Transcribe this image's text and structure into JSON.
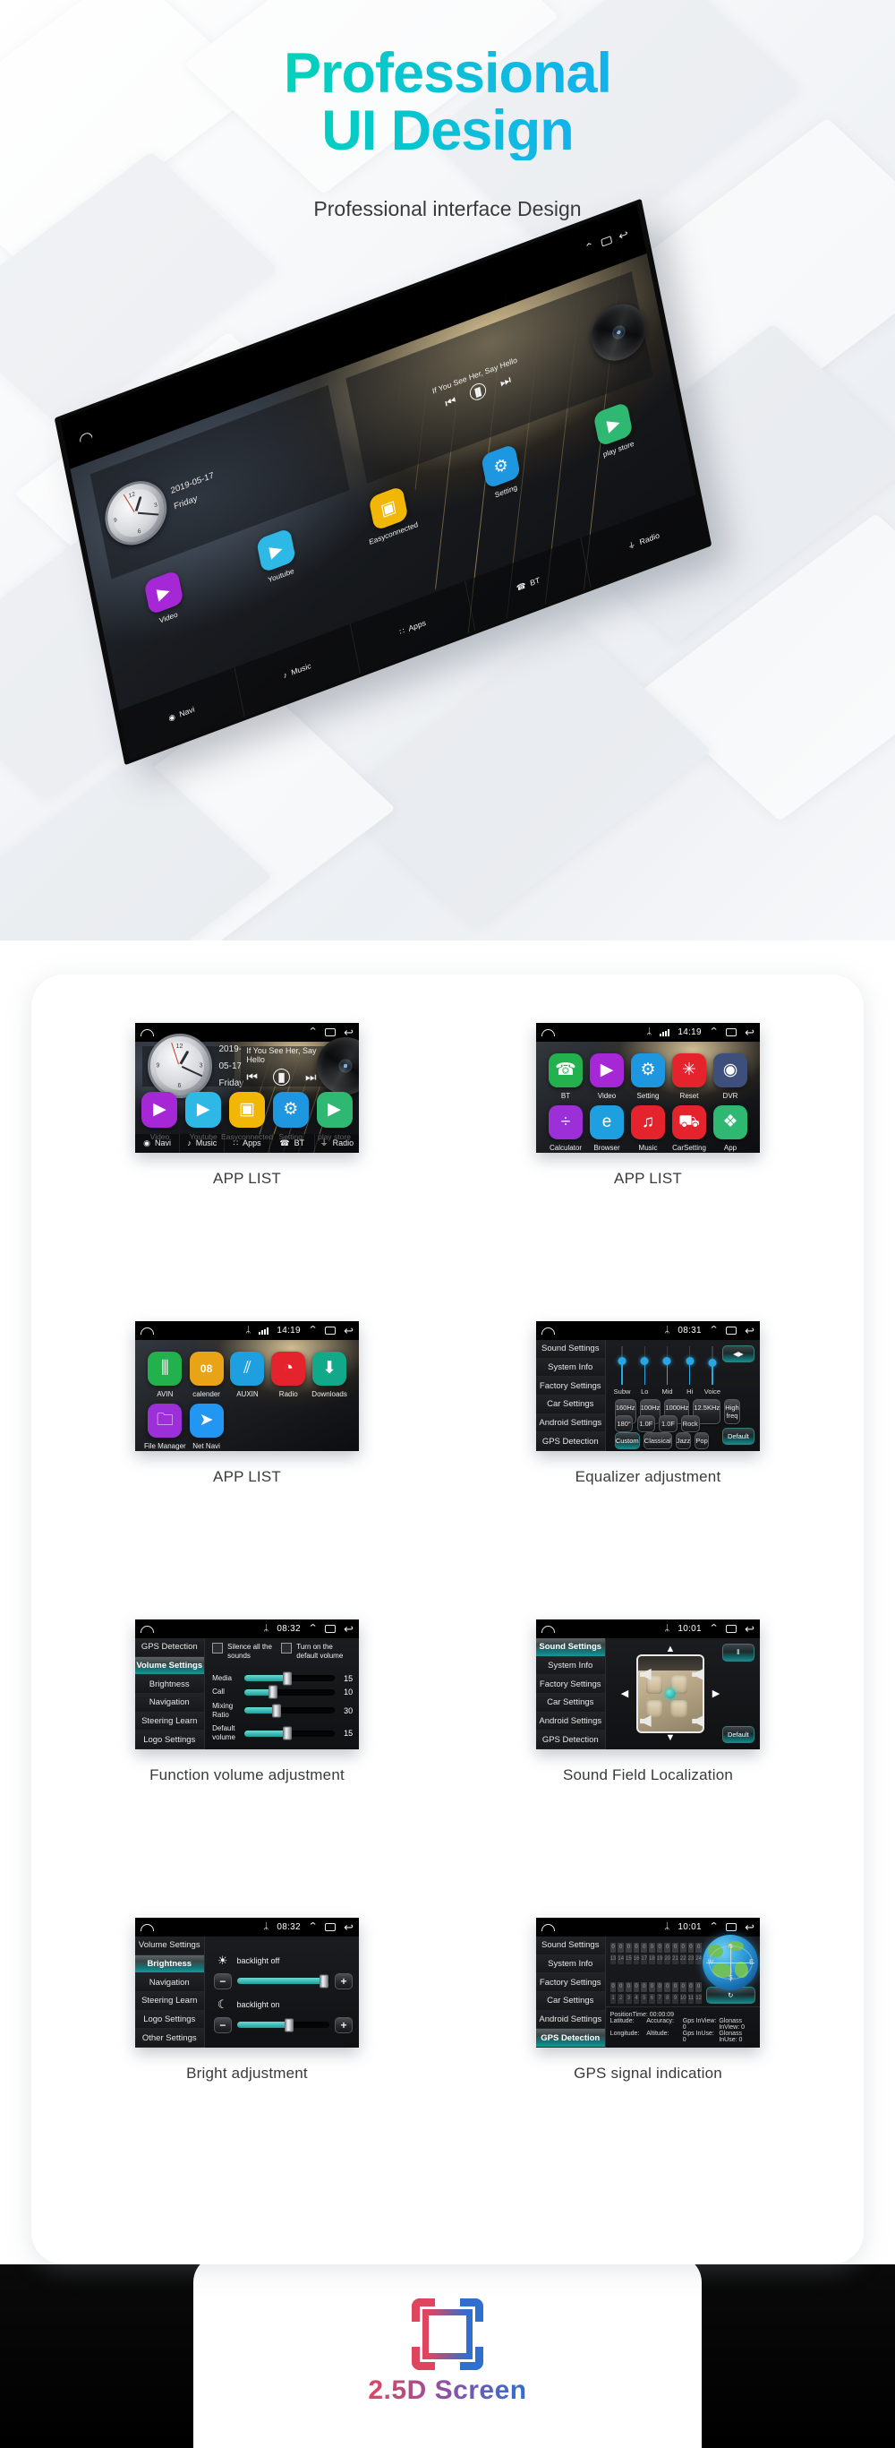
{
  "hero": {
    "title_line1": "Professional",
    "title_line2": "UI Design",
    "subtitle": "Professional interface Design",
    "gradient_start": "#00eb9b",
    "gradient_end": "#1f9cf5"
  },
  "home_screen": {
    "statusbar": {
      "home_icon": "home-icon",
      "up_icon": "collapse-icon",
      "recent_icon": "recents-icon",
      "back_icon": "back-icon"
    },
    "clock_widget": {
      "date": "2019-05-17",
      "weekday": "Friday",
      "numerals": [
        "12",
        "3",
        "6",
        "9"
      ]
    },
    "music_widget": {
      "track": "If You See Her, Say Hello",
      "prev": "❘◀",
      "play": "❘❘",
      "next": "▶❘"
    },
    "apps": [
      {
        "label": "Video",
        "icon": "video-icon",
        "color": "#a627d6"
      },
      {
        "label": "Youtube",
        "icon": "youtube-icon",
        "color": "#2eb8e6"
      },
      {
        "label": "Easyconnected",
        "icon": "easyconnected-icon",
        "color": "#f2b705"
      },
      {
        "label": "Setting",
        "icon": "gear-icon",
        "color": "#1e97e0"
      },
      {
        "label": "play store",
        "icon": "playstore-icon",
        "color": "#2eb872"
      }
    ],
    "dock": [
      {
        "label": "Navi",
        "icon": "location-pin-icon"
      },
      {
        "label": "Music",
        "icon": "music-note-icon"
      },
      {
        "label": "Apps",
        "icon": "grid-apps-icon"
      },
      {
        "label": "BT",
        "icon": "bluetooth-phone-icon"
      },
      {
        "label": "Radio",
        "icon": "radio-icon"
      }
    ]
  },
  "cards": [
    {
      "caption": "APP LIST",
      "type": "home",
      "statusbar": {
        "time": "",
        "bluetooth": false,
        "signal": false
      }
    },
    {
      "caption": "APP LIST",
      "type": "grid",
      "statusbar": {
        "time": "14:19",
        "bluetooth": true,
        "signal": true
      },
      "apps": [
        {
          "label": "BT",
          "icon": "bluetooth-phone-icon",
          "color": "#22b14c"
        },
        {
          "label": "Video",
          "icon": "video-icon",
          "color": "#a627d6"
        },
        {
          "label": "Setting",
          "icon": "gear-icon",
          "color": "#1e97e0"
        },
        {
          "label": "Reset",
          "icon": "reset-icon",
          "color": "#e5232c"
        },
        {
          "label": "DVR",
          "icon": "camera-icon",
          "color": "#3d4f7a"
        },
        {
          "label": "Calculator",
          "icon": "calculator-icon",
          "color": "#9b30d9"
        },
        {
          "label": "Browser",
          "icon": "browser-e-icon",
          "color": "#1e9fe0"
        },
        {
          "label": "Music",
          "icon": "headphones-icon",
          "color": "#e5232c"
        },
        {
          "label": "CarSetting",
          "icon": "car-settings-icon",
          "color": "#e5232c"
        },
        {
          "label": "App",
          "icon": "apps-grid-icon",
          "color": "#2eb872"
        }
      ]
    },
    {
      "caption": "APP LIST",
      "type": "grid",
      "statusbar": {
        "time": "14:19",
        "bluetooth": true,
        "signal": true
      },
      "apps": [
        {
          "label": "AVIN",
          "icon": "avin-plugs-icon",
          "color": "#22b14c"
        },
        {
          "label": "calender",
          "icon": "calendar-icon",
          "color": "#e8a317",
          "badge": "08"
        },
        {
          "label": "AUXIN",
          "icon": "auxin-plugs-icon",
          "color": "#1e9fe0"
        },
        {
          "label": "Radio",
          "icon": "radio-dial-icon",
          "color": "#e5232c"
        },
        {
          "label": "Downloads",
          "icon": "download-icon",
          "color": "#12a88a"
        },
        {
          "label": "File Manager",
          "icon": "folder-icon",
          "color": "#9b30d9"
        },
        {
          "label": "Net Navi",
          "icon": "paper-plane-icon",
          "color": "#2196f3"
        }
      ]
    },
    {
      "caption": "Equalizer adjustment",
      "type": "equalizer",
      "statusbar": {
        "time": "08:31",
        "bluetooth": true,
        "signal": false
      },
      "nav": [
        "Sound Settings",
        "System Info",
        "Factory Settings",
        "Car Settings",
        "Android Settings",
        "GPS Detection"
      ],
      "nav_active": -1,
      "sliders": [
        {
          "label": "Subw",
          "value": 62
        },
        {
          "label": "Lo",
          "value": 62
        },
        {
          "label": "Mid",
          "value": 62
        },
        {
          "label": "Hi",
          "value": 60
        },
        {
          "label": "Voice",
          "value": 56
        }
      ],
      "row1": [
        "160Hz",
        "100Hz",
        "1000Hz",
        "12.5KHz",
        "High freq"
      ],
      "row2": [
        "180°",
        "1.0F",
        "1.0F",
        "Rock"
      ],
      "row3": [
        "Custom",
        "Classical",
        "Jazz",
        "Pop"
      ],
      "row3_active": 0,
      "balance_button": "balance-icon",
      "default_button": "Default"
    },
    {
      "caption": "Function volume adjustment",
      "type": "volume",
      "statusbar": {
        "time": "08:32",
        "bluetooth": true,
        "signal": false
      },
      "nav": [
        "GPS Detection",
        "Volume Settings",
        "Brightness",
        "Navigation",
        "Steering Learn",
        "Logo Settings"
      ],
      "nav_active": 1,
      "checkboxes": [
        "Silence all the sounds",
        "Turn on the default volume"
      ],
      "rows": [
        {
          "label": "Media",
          "value": 15,
          "pct": 48
        },
        {
          "label": "Call",
          "value": 10,
          "pct": 32
        },
        {
          "label": "Mixing Ratio",
          "value": 30,
          "pct": 36
        },
        {
          "label": "Default volume",
          "value": 15,
          "pct": 48
        }
      ]
    },
    {
      "caption": "Sound Field Localization",
      "type": "soundfield",
      "statusbar": {
        "time": "10:01",
        "bluetooth": true,
        "signal": false
      },
      "nav": [
        "Sound Settings",
        "System Info",
        "Factory Settings",
        "Car Settings",
        "Android Settings",
        "GPS Detection"
      ],
      "nav_active": 0,
      "arrow_up": "▲",
      "arrow_down": "▼",
      "arrow_left": "◀",
      "arrow_right": "▶",
      "eq_button": "equalizer-icon",
      "default_button": "Default"
    },
    {
      "caption": "Bright adjustment",
      "type": "brightness",
      "statusbar": {
        "time": "08:32",
        "bluetooth": true,
        "signal": false
      },
      "nav": [
        "Volume Settings",
        "Brightness",
        "Navigation",
        "Steering Learn",
        "Logo Settings",
        "Other Settings"
      ],
      "nav_active": 1,
      "blocks": [
        {
          "icon": "sun-icon",
          "label": "backlight off",
          "pct": 94,
          "minus": "−",
          "plus": "+"
        },
        {
          "icon": "moon-icon",
          "label": "backlight on",
          "pct": 56,
          "minus": "−",
          "plus": "+"
        }
      ]
    },
    {
      "caption": "GPS signal indication",
      "type": "gps",
      "statusbar": {
        "time": "10:01",
        "bluetooth": true,
        "signal": false
      },
      "nav": [
        "Sound Settings",
        "System Info",
        "Factory Settings",
        "Car Settings",
        "Android Settings",
        "GPS Detection"
      ],
      "nav_active": 5,
      "top_values": [
        "0",
        "0",
        "0",
        "0",
        "0",
        "0",
        "0",
        "0",
        "0",
        "0",
        "0",
        "0"
      ],
      "top_index": [
        "13",
        "14",
        "15",
        "16",
        "17",
        "18",
        "19",
        "20",
        "21",
        "22",
        "23",
        "24"
      ],
      "bot_values": [
        "0",
        "0",
        "0",
        "0",
        "0",
        "0",
        "0",
        "0",
        "0",
        "0",
        "0",
        "0"
      ],
      "bot_index": [
        "1",
        "2",
        "3",
        "4",
        "5",
        "6",
        "7",
        "8",
        "9",
        "10",
        "11",
        "12"
      ],
      "compass": {
        "n": "N",
        "e": "E",
        "s": "S",
        "w": "W"
      },
      "refresh_button": "refresh-icon",
      "position_time": "PositionTime: 00:00:09",
      "info_rows": [
        [
          "Latitude:",
          "Accuracy:",
          "Gps InView: 0",
          "Glonass InView: 0"
        ],
        [
          "Longitude:",
          "Altitude:",
          "Gps InUse: 0",
          "Glonass InUse: 0"
        ]
      ]
    }
  ],
  "footer": {
    "logo": "scan-frame-icon",
    "title": "2.5D Screen",
    "color_left": "#e0455f",
    "color_right": "#2f6fd0"
  }
}
